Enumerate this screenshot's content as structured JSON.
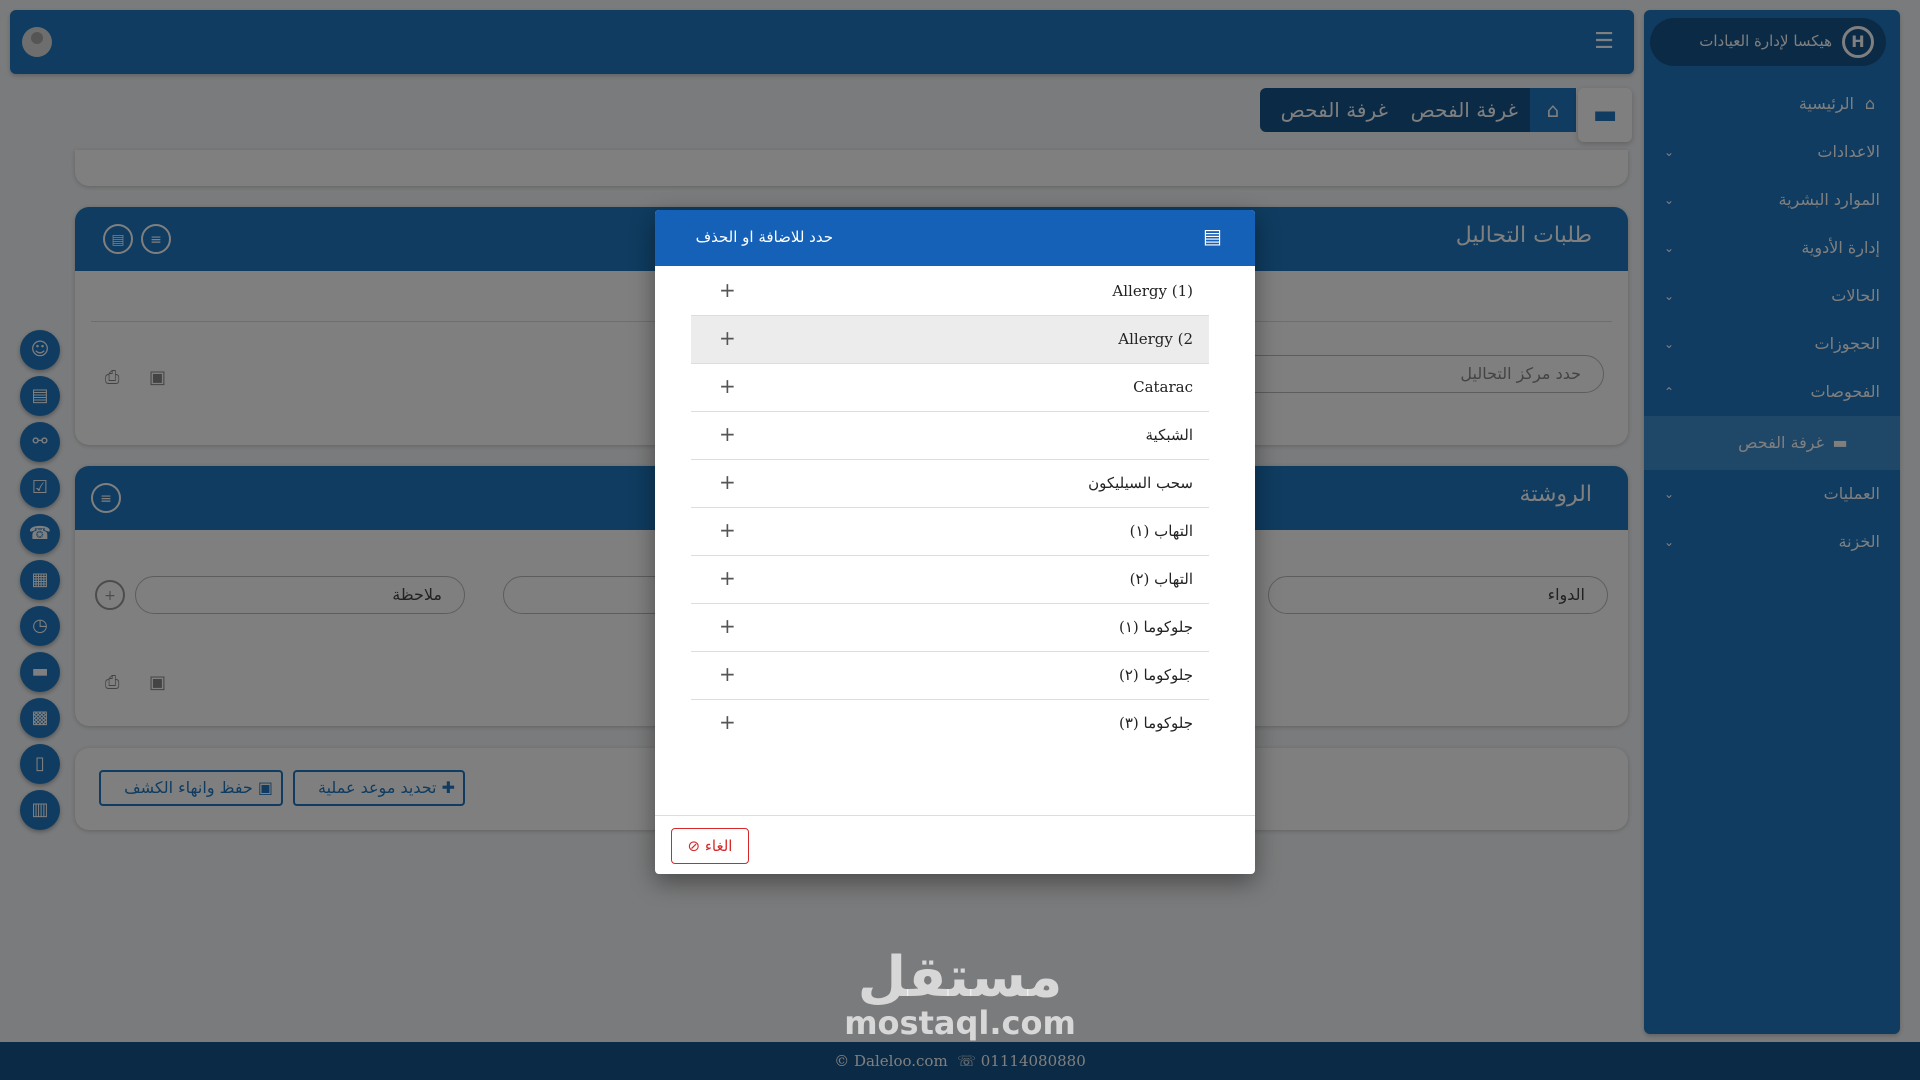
{
  "sidebar": {
    "brand": "هيكسا لإدارة العيادات",
    "brand_logo": "H",
    "items": [
      {
        "label": "الرئيسية"
      },
      {
        "label": "الاعدادات"
      },
      {
        "label": "الموارد البشرية"
      },
      {
        "label": "إدارة الأدوية"
      },
      {
        "label": "الحالات"
      },
      {
        "label": "الحجوزات"
      },
      {
        "label": "الفحوصات"
      },
      {
        "label": "غرفة الفحص"
      },
      {
        "label": "العمليات"
      },
      {
        "label": "الخزنة"
      }
    ]
  },
  "breadcrumb": {
    "current": "غرفة الفحص",
    "parent": "غرفة الفحص"
  },
  "lab_card": {
    "title": "طلبات التحاليل",
    "lab_center_placeholder": "حدد مركز التحاليل"
  },
  "rx_card": {
    "title": "الروشتة",
    "drug_placeholder": "الدواء",
    "note_placeholder": "ملاحظة"
  },
  "actions": {
    "save_finish": "حفظ وانهاء الكشف",
    "schedule_op": "تحديد موعد عملية"
  },
  "modal": {
    "title": "حدد للاضافة او الحذف",
    "items": [
      {
        "label": "Allergy (1)"
      },
      {
        "label": "Allergy (2"
      },
      {
        "label": "Catarac"
      },
      {
        "label": "الشبكية"
      },
      {
        "label": "سحب السيليكون"
      },
      {
        "label": "التهاب (١)"
      },
      {
        "label": "التهاب (٢)"
      },
      {
        "label": "جلوكوما (١)"
      },
      {
        "label": "جلوكوما (٢)"
      },
      {
        "label": "جلوكوما (٣)"
      }
    ],
    "cancel": "الغاء"
  },
  "footer": {
    "website": "Daleloo.com",
    "phone": "01114080880"
  },
  "watermark": {
    "arabic": "مستقل",
    "latin": "mostaql.com"
  },
  "colors": {
    "primary": "#1f78c1",
    "dark": "#16548a",
    "modal_header": "#1561b8",
    "danger": "#d62828"
  }
}
